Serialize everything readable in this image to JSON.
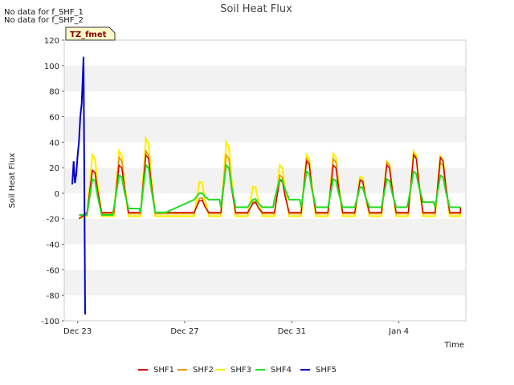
{
  "notes": [
    "No data for f_SHF_1",
    "No data for f_SHF_2"
  ],
  "badge": "TZ_fmet",
  "chart_data": {
    "type": "line",
    "title": "Soil Heat Flux",
    "xlabel": "Time",
    "ylabel": "Soil Heat Flux",
    "ylim": [
      -100,
      120
    ],
    "yticks": [
      -100,
      -80,
      -60,
      -40,
      -20,
      0,
      20,
      40,
      60,
      80,
      100,
      120
    ],
    "xlim": [
      -0.5,
      14.5
    ],
    "xticks": [
      {
        "x": 0,
        "label": "Dec 23"
      },
      {
        "x": 4,
        "label": "Dec 27"
      },
      {
        "x": 8,
        "label": "Dec 31"
      },
      {
        "x": 12,
        "label": "Jan 4"
      }
    ],
    "grid": "alternating horizontal bands",
    "legend_position": "bottom",
    "series": [
      {
        "name": "SHF1",
        "color": "#cc0000"
      },
      {
        "name": "SHF2",
        "color": "#e69500"
      },
      {
        "name": "SHF3",
        "color": "#ffee00"
      },
      {
        "name": "SHF4",
        "color": "#22dd22"
      },
      {
        "name": "SHF5",
        "color": "#0000cc"
      }
    ],
    "daily_peaks": {
      "days": [
        0.6,
        1.6,
        2.6,
        4.6,
        5.6,
        6.6,
        7.6,
        8.6,
        9.6,
        10.6,
        11.6,
        12.6,
        13.6
      ],
      "SHF1": [
        18,
        22,
        30,
        -6,
        22,
        -8,
        10,
        25,
        22,
        10,
        22,
        30,
        28
      ],
      "SHF2": [
        18,
        28,
        33,
        -4,
        30,
        -7,
        14,
        27,
        27,
        11,
        24,
        31,
        24
      ],
      "SHF3": [
        30,
        33,
        43,
        9,
        40,
        5,
        22,
        30,
        31,
        13,
        25,
        33,
        29
      ],
      "SHF4": [
        11,
        14,
        22,
        0,
        22,
        -5,
        11,
        17,
        11,
        5,
        11,
        17,
        14
      ],
      "troughs_SHF4": [
        -17,
        -12,
        -15,
        -5,
        -11,
        -11,
        -5,
        -11,
        -11,
        -11,
        -11,
        -7,
        -11
      ]
    },
    "SHF5": {
      "x": [
        -0.2,
        -0.15,
        -0.1,
        -0.05,
        0.0,
        0.05,
        0.1,
        0.15,
        0.2,
        0.22,
        0.25,
        0.28
      ],
      "y": [
        7,
        25,
        8,
        15,
        30,
        40,
        60,
        70,
        95,
        107,
        10,
        -95
      ]
    }
  },
  "legend": [
    "SHF1",
    "SHF2",
    "SHF3",
    "SHF4",
    "SHF5"
  ]
}
